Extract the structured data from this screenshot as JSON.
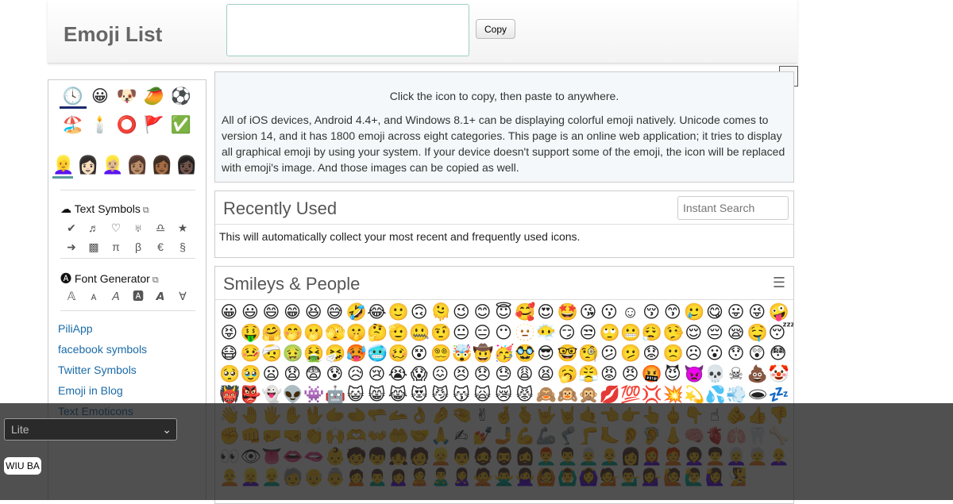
{
  "header": {
    "title": "Emoji List",
    "copy_label": "Copy"
  },
  "close_label": "×",
  "sidebar": {
    "categories": [
      "🕓",
      "😀",
      "🐶",
      "🥭",
      "⚽",
      "🏖️",
      "🕯️",
      "⭕",
      "🚩",
      "✅"
    ],
    "skins": [
      "👱‍♀️",
      "👩🏻",
      "👱🏼‍♀️",
      "👩🏽",
      "👩🏾",
      "👩🏿"
    ],
    "text_symbols": {
      "icon": "☁",
      "label": "Text Symbols",
      "ext": "⧉",
      "items": [
        "✔",
        "♬",
        "♡",
        "♅",
        "♎",
        "★",
        "➜",
        "▩",
        "π",
        "β",
        "€",
        "§"
      ]
    },
    "font_generator": {
      "icon": "🅐",
      "label": "Font Generator",
      "ext": "⧉",
      "items": [
        "𝔸",
        "ᴀ",
        "𝘈",
        "🅰",
        "𝘼",
        "∀"
      ]
    },
    "links": [
      "PiliApp",
      "facebook symbols",
      "Twitter Symbols",
      "Emoji in Blog",
      "Text Emoticons"
    ]
  },
  "intro": {
    "line1": "Click the icon to copy, then paste to anywhere.",
    "body": "All of iOS devices, Android 4.4+, and Windows 8.1+ can be displaying colorful emoji natively. Unicode comes to version 14, and it has 1800 emoji across eight categories. This page is an online web application; it tries to display all graphical emoji by using your system. If your device doesn't support some of the emoji, the icon will be replaced with emoji's image. And those images can be copied as well."
  },
  "recent": {
    "title": "Recently Used",
    "search_placeholder": "Instant Search",
    "body": "This will automatically collect your most recent and frequently used icons."
  },
  "smileys": {
    "title": "Smileys & People",
    "menu_icon": "☰",
    "emojis": "😀😃😄😁😆😅🤣😂🙂🙃🫠😉😊😇🥰😍🤩😘😗☺😚😙🥲😋😛😜🤪😝🤑🤗🤭🫢🫣🤫🤔🫡🤐🤨😐😑😶🫥😶‍🌫️😏😒🙄😬😮‍💨🤥😌😔😪🤤😴😷🤒🤕🤢🤮🤧🥵🥶🥴😵😵‍💫🤯🤠🥳🥸😎🤓🧐😕🫤😟🙁☹😮😯😲😳🥺🥹😦😧😨😰😥😢😭😱😖😣😞😓😩😫🥱😤😡😠🤬😈👿💀☠💩🤡👹👺👻👽👾🤖😺😸😹😻😼😽🙀😿😾🙈🙉🙊💋💯💢💥💫💦💨🕳💤👋🤚🖐✋🖖🫱🫲🫳🫴👌🤌🤏✌🤞🫰🤟🤘🤙👈👉👆🖕👇☝🫵👍👎✊👊🤛🤜👏🙌🫶👐🤲🤝🙏✍💅🤳💪🦾🦿🦵🦶👂🦻👃🧠🫀🫁🦷🦴👀👁👅👄🫦👶🧒👦👧🧑👱👨🧔🧔‍♂️🧔‍♀️👨‍🦰👨‍🦱👨‍🦳👨‍🦲👩👩‍🦰🧑‍🦰👩‍🦱🧑‍🦱👩‍🦳🧑‍🦳👩‍🦲🧑‍🦲👱‍♀️👱‍♂️🧓👴👵🙍🙍‍♂️🙍‍♀️🙎🙎‍♂️🙎‍♀️🙅🙅‍♂️🙅‍♀️🙆🙆‍♂️🙆‍♀️💁💁‍♂️💁‍♀️🙋🙋‍♂️🙋‍♀️🧏"
  },
  "overlay": {
    "select_value": "Lite",
    "badge": "WIU BA"
  }
}
